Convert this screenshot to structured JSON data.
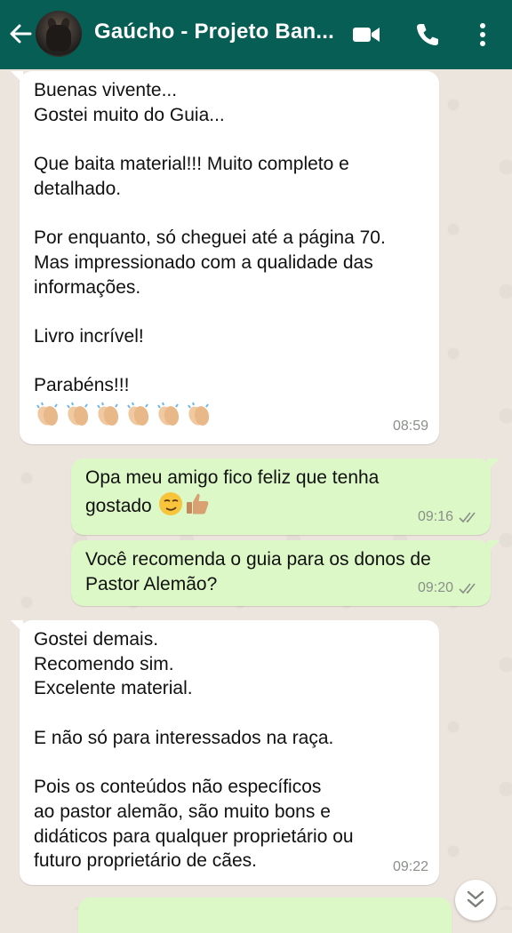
{
  "header": {
    "title": "Gaúcho - Projeto Ban...",
    "colors": {
      "bar": "#075e54"
    },
    "icons": [
      "back-arrow-icon",
      "video-call-icon",
      "phone-icon",
      "more-vert-icon"
    ]
  },
  "messages": [
    {
      "direction": "in",
      "lines": [
        "Buenas vivente...",
        "Gostei muito do Guia...",
        "",
        "Que baita material!!! Muito completo e",
        "detalhado.",
        "",
        "Por enquanto, só cheguei até a página 70.",
        "Mas impressionado com a qualidade das",
        "informações.",
        "",
        "Livro incrível!",
        "",
        "Parabéns!!!"
      ],
      "emoji": "clapping-hands x6",
      "time": "08:59"
    },
    {
      "direction": "out",
      "lines": [
        "Opa meu amigo fico feliz que tenha",
        "gostado"
      ],
      "emoji": "smirk-face, thumbs-up",
      "time": "09:16",
      "status": "read"
    },
    {
      "direction": "out",
      "lines": [
        "Você recomenda o guia para os donos de",
        "Pastor Alemão?"
      ],
      "time": "09:20",
      "status": "read"
    },
    {
      "direction": "in",
      "lines": [
        "Gostei demais.",
        "Recomendo sim.",
        "Excelente material.",
        "",
        "E não só para interessados na raça.",
        "",
        "Pois os conteúdos não específicos",
        "ao pastor alemão, são muito bons e",
        "didáticos para qualquer proprietário ou",
        "futuro proprietário de cães."
      ],
      "time": "09:22"
    }
  ],
  "colors": {
    "incoming": "#ffffff",
    "outgoing": "#dcf8c6",
    "wallpaper": "#ece5dd",
    "time": "#8a8f8a",
    "tick": "#8a8f8a"
  }
}
